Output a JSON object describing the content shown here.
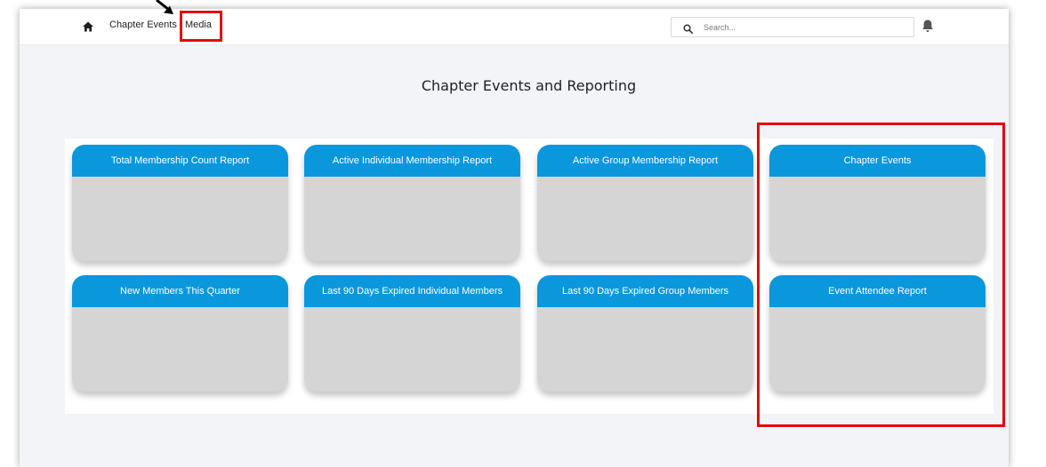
{
  "nav": {
    "links": [
      "Chapter Events",
      "Media"
    ]
  },
  "search": {
    "placeholder": "Search..."
  },
  "page": {
    "title": "Chapter Events and Reporting"
  },
  "cards": [
    "Total Membership Count Report",
    "Active Individual Membership Report",
    "Active Group Membership Report",
    "Chapter Events",
    "New Members This Quarter",
    "Last 90 Days Expired Individual Members",
    "Last 90 Days Expired Group Members",
    "Event Attendee Report"
  ],
  "colors": {
    "card_header": "#0b97dc",
    "card_body": "#d5d5d5",
    "annotation": "#e10b0b"
  },
  "icons": {
    "home": "home-icon",
    "search": "search-icon",
    "notifications": "bell-icon"
  }
}
